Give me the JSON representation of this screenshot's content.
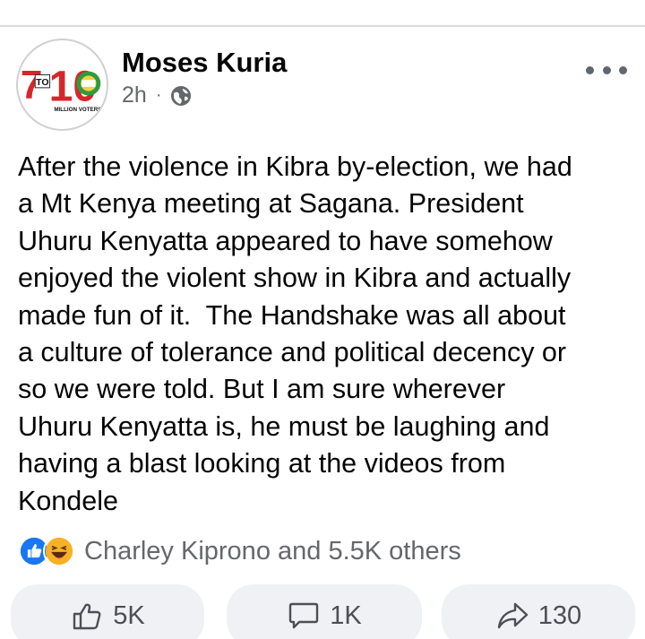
{
  "post": {
    "author": "Moses Kuria",
    "time": "2h",
    "separator": "·",
    "privacy_icon": "globe-icon",
    "avatar": {
      "logo_text_a": "7",
      "logo_text_to": "TO",
      "logo_text_b": "10",
      "logo_caption": "MILLION VOTERS"
    },
    "text": "After the violence in Kibra by-election, we had\na Mt Kenya meeting at Sagana. President\nUhuru Kenyatta appeared to have somehow\nenjoyed the violent show in Kibra and actually\nmade fun of it.  The Handshake was all about\na culture of tolerance and political decency or\nso we were told. But I am sure wherever\nUhuru Kenyatta is, he must be laughing and\nhaving a blast looking at the videos from\nKondele"
  },
  "reactions": {
    "icons": [
      "like-reaction-icon",
      "haha-reaction-icon"
    ],
    "summary": "Charley Kiprono and 5.5K others"
  },
  "actions": {
    "like_count": "5K",
    "comment_count": "1K",
    "share_count": "130"
  },
  "colors": {
    "like_blue": "#1877f2",
    "haha_yellow": "#f7b125",
    "logo_red": "#d7262b",
    "logo_green": "#2e9b3e",
    "muted_text": "#65676b",
    "button_bg": "#eff1f4"
  }
}
